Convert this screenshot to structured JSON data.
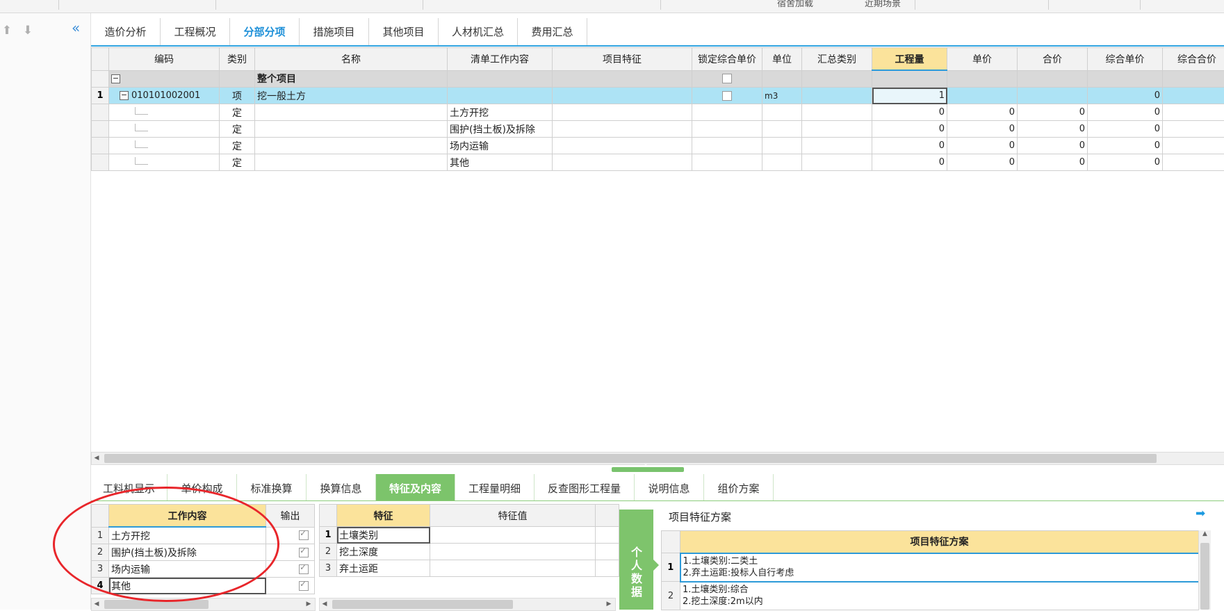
{
  "top_strip": {
    "buttons": [
      "宿舍加载",
      "近期场景"
    ]
  },
  "left_bar": {
    "up_icon": "⬆",
    "down_icon": "⬇",
    "collapse_icon": "«"
  },
  "tabs": [
    {
      "label": "造价分析",
      "active": false
    },
    {
      "label": "工程概况",
      "active": false
    },
    {
      "label": "分部分项",
      "active": true
    },
    {
      "label": "措施项目",
      "active": false
    },
    {
      "label": "其他项目",
      "active": false
    },
    {
      "label": "人材机汇总",
      "active": false
    },
    {
      "label": "费用汇总",
      "active": false
    }
  ],
  "main_grid": {
    "headers": [
      "编码",
      "类别",
      "名称",
      "清单工作内容",
      "项目特征",
      "锁定综合单价",
      "单位",
      "汇总类别",
      "工程量",
      "单价",
      "合价",
      "综合单价",
      "综合合价"
    ],
    "highlighted_header": "工程量",
    "total_row": {
      "expand_icon": "−",
      "name": "整个项目"
    },
    "item_row": {
      "row_no": "1",
      "expand_icon": "−",
      "code": "010101002001",
      "category": "项",
      "name": "挖一般土方",
      "unit": "m3",
      "quantity": "1",
      "unit_comprehensive_price": "0"
    },
    "sub_rows": [
      {
        "category": "定",
        "work_content": "土方开挖",
        "quantity": "0",
        "unit_price": "0",
        "total_price": "0",
        "comp_unit_price": "0"
      },
      {
        "category": "定",
        "work_content": "围护(挡土板)及拆除",
        "quantity": "0",
        "unit_price": "0",
        "total_price": "0",
        "comp_unit_price": "0"
      },
      {
        "category": "定",
        "work_content": "场内运输",
        "quantity": "0",
        "unit_price": "0",
        "total_price": "0",
        "comp_unit_price": "0"
      },
      {
        "category": "定",
        "work_content": "其他",
        "quantity": "0",
        "unit_price": "0",
        "total_price": "0",
        "comp_unit_price": "0"
      }
    ]
  },
  "bottom_tabs": [
    {
      "label": "工料机显示",
      "active": false
    },
    {
      "label": "单价构成",
      "active": false
    },
    {
      "label": "标准换算",
      "active": false
    },
    {
      "label": "换算信息",
      "active": false
    },
    {
      "label": "特征及内容",
      "active": true
    },
    {
      "label": "工程量明细",
      "active": false
    },
    {
      "label": "反查图形工程量",
      "active": false
    },
    {
      "label": "说明信息",
      "active": false
    },
    {
      "label": "组价方案",
      "active": false
    }
  ],
  "work_content_grid": {
    "headers": [
      "工作内容",
      "输出"
    ],
    "rows": [
      {
        "no": "1",
        "content": "土方开挖",
        "output": true
      },
      {
        "no": "2",
        "content": "围护(挡土板)及拆除",
        "output": true
      },
      {
        "no": "3",
        "content": "场内运输",
        "output": true
      },
      {
        "no": "4",
        "content": "其他",
        "output": true
      }
    ]
  },
  "feature_grid": {
    "headers": [
      "特征",
      "特征值"
    ],
    "rows": [
      {
        "no": "1",
        "feature": "土壤类别",
        "value": ""
      },
      {
        "no": "2",
        "feature": "挖土深度",
        "value": ""
      },
      {
        "no": "3",
        "feature": "弃土运距",
        "value": ""
      }
    ]
  },
  "personal_data_button": "个人数据",
  "scheme_panel": {
    "title": "项目特征方案",
    "arrow_icon": "➡",
    "header": "项目特征方案",
    "rows": [
      {
        "no": "1",
        "lines": [
          "1.土壤类别:二类土",
          "2.弃土运距:投标人自行考虑"
        ]
      },
      {
        "no": "2",
        "lines": [
          "1.土壤类别:综合",
          "2.挖土深度:2m以内"
        ]
      }
    ]
  },
  "annotation": {
    "color": "#e8262b"
  }
}
